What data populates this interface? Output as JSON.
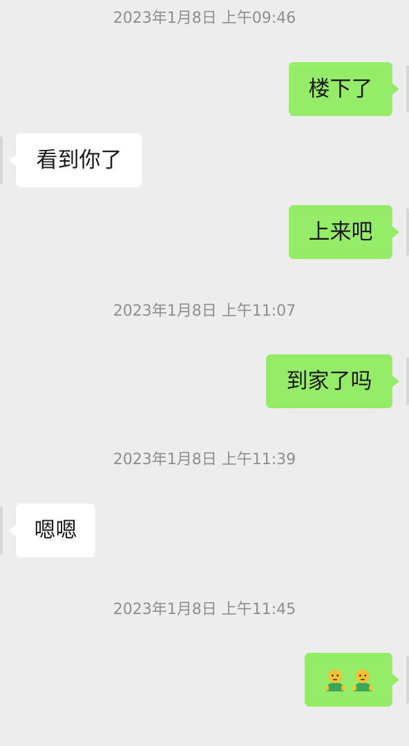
{
  "timestamps": [
    "2023年1月8日 上午09:46",
    "2023年1月8日 上午11:07",
    "2023年1月8日 上午11:39",
    "2023年1月8日 上午11:45"
  ],
  "messages": [
    {
      "side": "out",
      "text": "楼下了"
    },
    {
      "side": "in",
      "text": "看到你了"
    },
    {
      "side": "out",
      "text": "上来吧"
    },
    {
      "side": "out",
      "text": "到家了吗"
    },
    {
      "side": "in",
      "text": "嗯嗯"
    },
    {
      "side": "out",
      "emojis": [
        "person-green-shirt-emoji",
        "person-green-shirt-emoji"
      ]
    }
  ],
  "colors": {
    "background": "#ededed",
    "outgoing_bubble": "#95ec69",
    "incoming_bubble": "#ffffff",
    "timestamp_text": "#8e8e8e",
    "message_text": "#191919"
  }
}
